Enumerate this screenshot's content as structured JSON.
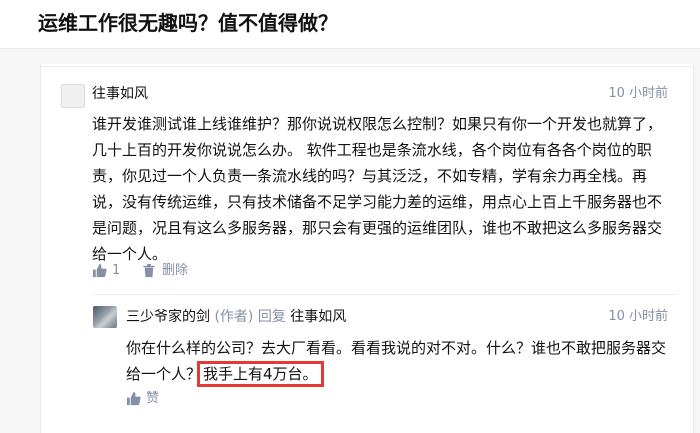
{
  "question": {
    "title": "运维工作很无趣吗？值不值得做？"
  },
  "comment": {
    "author": "往事如风",
    "time": "10 小时前",
    "text": "谁开发谁测试谁上线谁维护？那你说说权限怎么控制？如果只有你一个开发也就算了，几十上百的开发你说说怎么办。 软件工程也是条流水线，各个岗位有各各个岗位的职责，你见过一个人负责一条流水线的吗？与其泛泛，不如专精，学有余力再全栈。再说，没有传统运维，只有技术储备不足学习能力差的运维，用点心上百上千服务器也不是问题，况且有这么多服务器，那只会有更强的运维团队，谁也不敢把这么多服务器交给一个人。",
    "likes": "1",
    "delete_label": "删除"
  },
  "reply": {
    "author": "三少爷家的剑",
    "author_tag": "(作者)",
    "verb": "回复",
    "target": "往事如风",
    "time": "10 小时前",
    "text_main": "你在什么样的公司？去大厂看看。看看我说的对不对。什么？谁也不敢把服务器交给一个人？",
    "text_highlight": "我手上有4万台。",
    "like_label": "赞"
  },
  "colors": {
    "accent": "#8590a6",
    "highlight_border": "#e53935"
  }
}
